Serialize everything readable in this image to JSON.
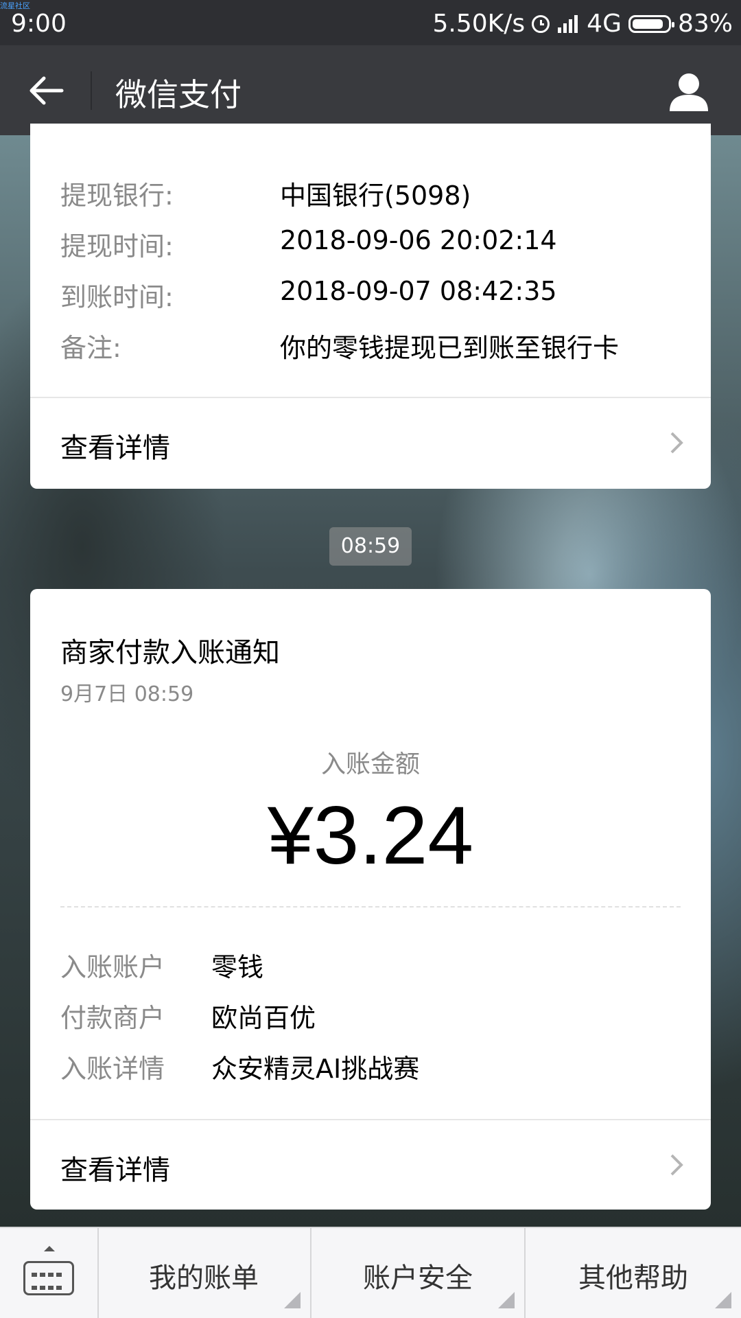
{
  "status_bar": {
    "time": "9:00",
    "corner_mark": "流星社区",
    "speed": "5.50K/s",
    "network": "4G",
    "battery": "83%"
  },
  "nav": {
    "title": "微信支付",
    "icons": [
      "back-arrow-icon",
      "profile-icon"
    ]
  },
  "withdraw_card": {
    "rows": [
      {
        "label": "提现银行:",
        "value": "中国银行(5098)"
      },
      {
        "label": "提现时间:",
        "value": "2018-09-06 20:02:14"
      },
      {
        "label": "到账时间:",
        "value": "2018-09-07 08:42:35"
      },
      {
        "label": "备注:",
        "value": "你的零钱提现已到账至银行卡"
      }
    ],
    "detail_label": "查看详情"
  },
  "time_pill": "08:59",
  "payment_card": {
    "title": "商家付款入账通知",
    "date": "9月7日  08:59",
    "amount_label": "入账金额",
    "amount": "¥3.24",
    "rows": [
      {
        "label": "入账账户",
        "value": "零钱"
      },
      {
        "label": "付款商户",
        "value": "欧尚百优"
      },
      {
        "label": "入账详情",
        "value": "众安精灵AI挑战赛"
      }
    ],
    "detail_label": "查看详情"
  },
  "tab_bar": {
    "tabs": [
      "我的账单",
      "账户安全",
      "其他帮助"
    ]
  }
}
